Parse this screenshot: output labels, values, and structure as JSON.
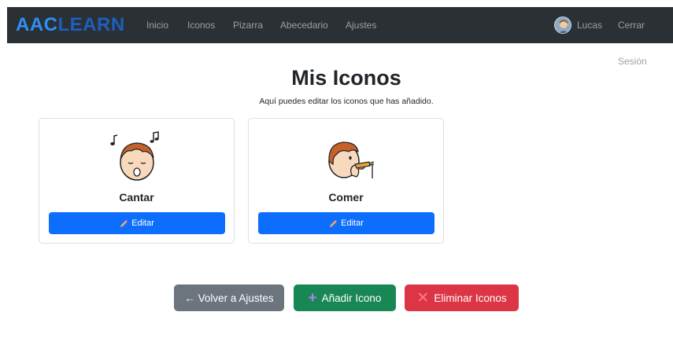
{
  "brand": {
    "part1": "AAC",
    "part2": "LEARN"
  },
  "nav": {
    "links": [
      "Inicio",
      "Iconos",
      "Pizarra",
      "Abecedario",
      "Ajustes"
    ],
    "user_name": "Lucas",
    "logout_label": "Cerrar Sesión"
  },
  "main": {
    "title": "Mis Iconos",
    "subtitle": "Aquí puedes editar los iconos que has añadido."
  },
  "cards": [
    {
      "label": "Cantar",
      "icon": "singing-boy-icon",
      "edit_label": "Editar"
    },
    {
      "label": "Comer",
      "icon": "eating-boy-icon",
      "edit_label": "Editar"
    }
  ],
  "actions": {
    "back_label": "← Volver a Ajustes",
    "add_label": "Añadir Icono",
    "delete_label": "Eliminar Iconos"
  },
  "colors": {
    "navbar": "#2b3035",
    "primary": "#0d6efd",
    "secondary": "#6c757d",
    "success": "#198754",
    "danger": "#dc3545"
  }
}
